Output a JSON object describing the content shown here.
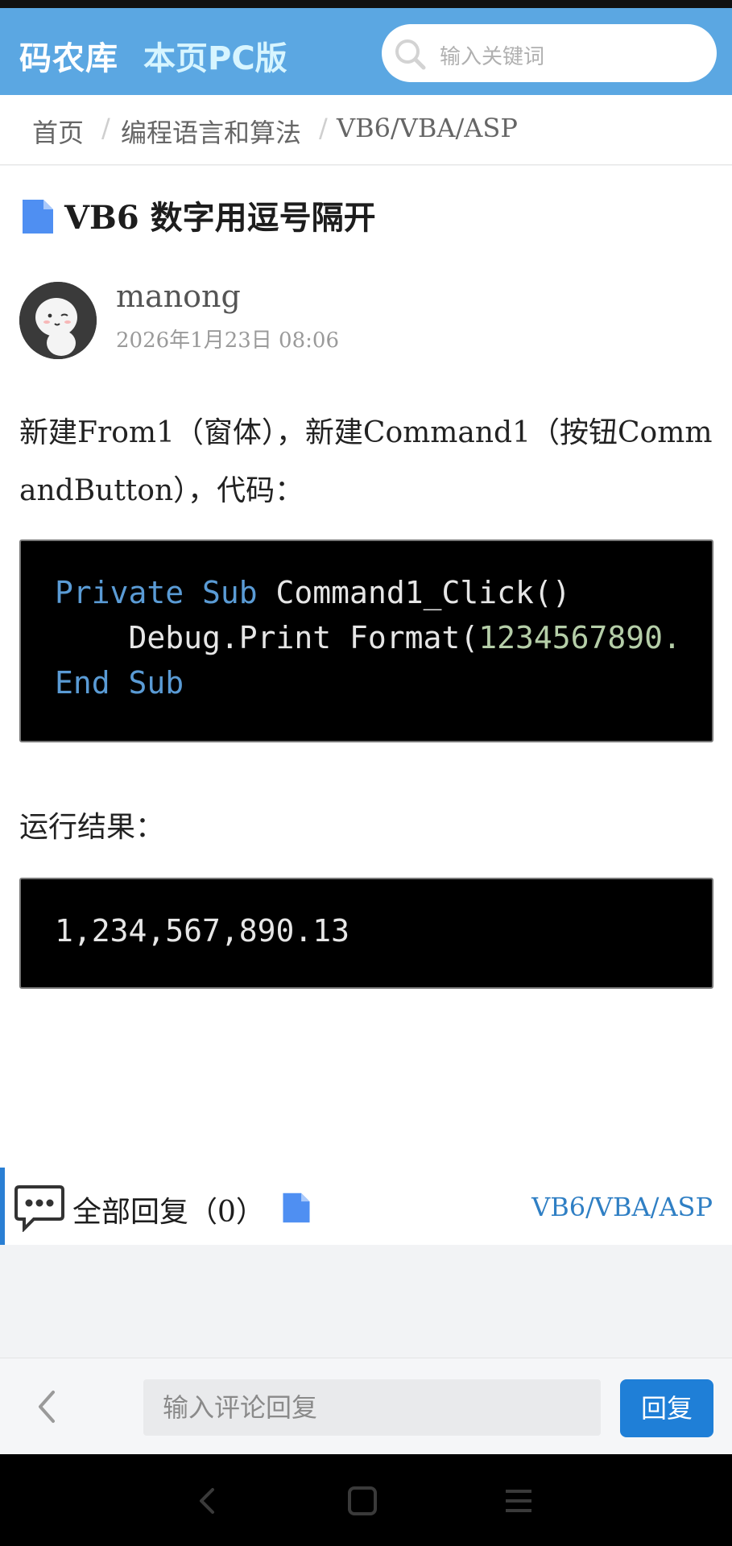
{
  "header": {
    "brand": "码农库",
    "pc_link": "本页PC版",
    "search_placeholder": "输入关键词"
  },
  "breadcrumb": {
    "items": [
      "首页",
      "编程语言和算法",
      "VB6/VBA/ASP"
    ],
    "separator": "/"
  },
  "article": {
    "title": "VB6 数字用逗号隔开",
    "author": "manong",
    "date": "2026年1月23日 08:06",
    "intro": "新建From1（窗体），新建Command1（按钮CommandButton），代码：",
    "code": {
      "line1_kw": "Private Sub",
      "line1_rest": " Command1_Click()",
      "line2_prefix": "    Debug.Print Format(",
      "line2_num": "1234567890.",
      "line3_kw": "End Sub"
    },
    "result_label": "运行结果：",
    "result_output": "1,234,567,890.13"
  },
  "replies": {
    "label": "全部回复（0）",
    "category": "VB6/VBA/ASP"
  },
  "comment_bar": {
    "placeholder": "输入评论回复",
    "button": "回复"
  },
  "colors": {
    "header_bg": "#5ba7e2",
    "accent_blue": "#1f7fd7",
    "code_bg": "#000000",
    "code_keyword": "#5a9bd5",
    "code_number": "#b5cea8"
  },
  "icons": [
    "search-icon",
    "document-icon",
    "chat-icon",
    "back-icon",
    "nav-back-icon",
    "nav-home-icon",
    "nav-menu-icon"
  ]
}
